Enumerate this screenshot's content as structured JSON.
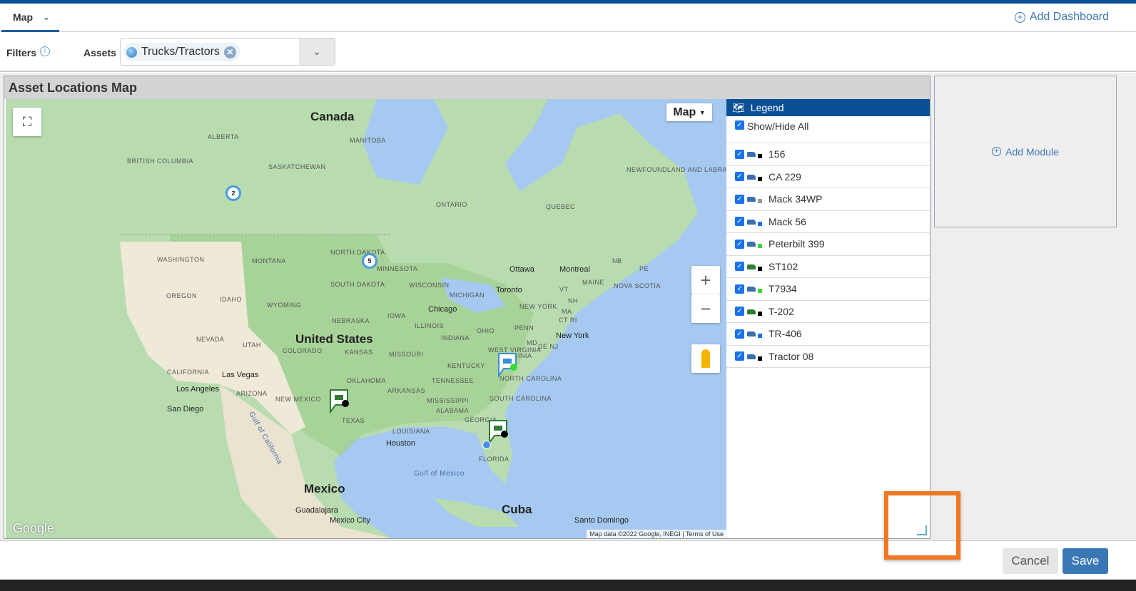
{
  "tab": {
    "label": "Map"
  },
  "add_dashboard": "Add Dashboard",
  "filters": {
    "label": "Filters",
    "assets_label": "Assets",
    "chip": "Trucks/Tractors"
  },
  "module": {
    "title": "Asset Locations Map"
  },
  "map": {
    "type_button": "Map",
    "attribution": "Map data ©2022 Google, INEGI",
    "terms": "Terms of Use",
    "google": "Google",
    "labels": {
      "canada": "Canada",
      "us": "United States",
      "mexico": "Mexico",
      "cuba": "Cuba",
      "alberta": "ALBERTA",
      "bc": "BRITISH COLUMBIA",
      "manitoba": "MANITOBA",
      "sask": "SASKATCHEWAN",
      "ontario": "ONTARIO",
      "quebec": "QUEBEC",
      "nl": "NEWFOUNDLAND AND LABRADOR",
      "wa": "WASHINGTON",
      "mt": "MONTANA",
      "nd": "NORTH DAKOTA",
      "mn": "MINNESOTA",
      "or": "OREGON",
      "id": "IDAHO",
      "wy": "WYOMING",
      "sd": "SOUTH DAKOTA",
      "wi": "WISCONSIN",
      "mi": "MICHIGAN",
      "nv": "NEVADA",
      "ut": "UTAH",
      "co": "COLORADO",
      "ne": "NEBRASKA",
      "ia": "IOWA",
      "il": "ILLINOIS",
      "in": "INDIANA",
      "oh": "OHIO",
      "ks": "KANSAS",
      "mo": "MISSOURI",
      "ca": "CALIFORNIA",
      "az": "ARIZONA",
      "nm": "NEW MEXICO",
      "ok": "OKLAHOMA",
      "ar": "ARKANSAS",
      "tn": "TENNESSEE",
      "ky": "KENTUCKY",
      "ms": "MISSISSIPPI",
      "al": "ALABAMA",
      "tx": "TEXAS",
      "la": "LOUISIANA",
      "ga": "GEORGIA",
      "fl": "FLORIDA",
      "sc": "SOUTH CAROLINA",
      "nc": "NORTH CAROLINA",
      "va": "VIRGINIA",
      "wv": "WEST VIRGINIA",
      "pa": "PENN",
      "ny": "NEW YORK",
      "me": "MAINE",
      "vt": "VT",
      "nh": "NH",
      "ma": "MA",
      "ct": "CT RI",
      "md": "MD",
      "de": "DE NJ",
      "nb": "NB",
      "pe": "PE",
      "ns": "NOVA SCOTIA",
      "gulf": "Gulf of Mexico",
      "gulfca": "Gulf of California"
    },
    "cities": {
      "ottawa": "Ottawa",
      "montreal": "Montreal",
      "toronto": "Toronto",
      "chicago": "Chicago",
      "newyork": "New York",
      "lasvegas": "Las Vegas",
      "losangeles": "Los Angeles",
      "sandiego": "San Diego",
      "houston": "Houston",
      "guadalajara": "Guadalajara",
      "mexicocity": "Mexico City",
      "santo": "Santo Domingo"
    },
    "clusters": [
      "2",
      "5"
    ]
  },
  "legend": {
    "title": "Legend",
    "show_hide": "Show/Hide All",
    "items": [
      {
        "label": "156",
        "color": "#000000"
      },
      {
        "label": "CA 229",
        "color": "#000000"
      },
      {
        "label": "Mack 34WP",
        "color": "#999999"
      },
      {
        "label": "Mack 56",
        "color": "#1a73e8"
      },
      {
        "label": "Peterbilt 399",
        "color": "#33dd33"
      },
      {
        "label": "ST102",
        "color": "#000000"
      },
      {
        "label": "T7934",
        "color": "#33dd33"
      },
      {
        "label": "T-202",
        "color": "#000000"
      },
      {
        "label": "TR-406",
        "color": "#1a73e8"
      },
      {
        "label": "Tractor 08",
        "color": "#000000"
      }
    ]
  },
  "add_module": "Add Module",
  "footer": {
    "cancel": "Cancel",
    "save": "Save"
  }
}
